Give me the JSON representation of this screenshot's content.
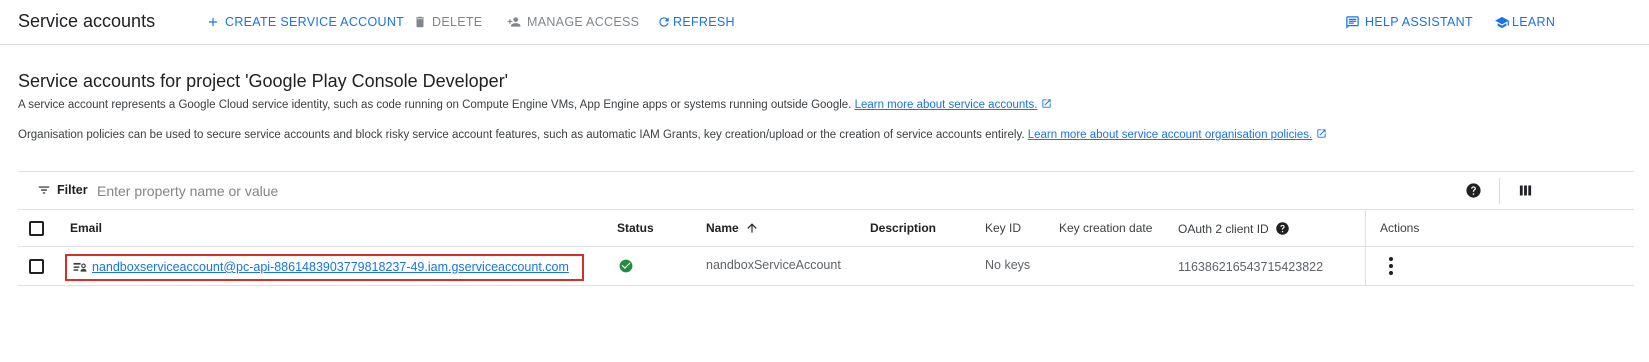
{
  "header": {
    "title": "Service accounts",
    "create_label": "CREATE SERVICE ACCOUNT",
    "delete_label": "DELETE",
    "manage_access_label": "MANAGE ACCESS",
    "refresh_label": "REFRESH",
    "help_assistant_label": "HELP ASSISTANT",
    "learn_label": "LEARN"
  },
  "main": {
    "title": "Service accounts for project 'Google Play Console Developer'",
    "description1": "A service account represents a Google Cloud service identity, such as code running on Compute Engine VMs, App Engine apps or systems running outside Google.",
    "description1_link": "Learn more about service accounts.",
    "description2": "Organisation policies can be used to secure service accounts and block risky service account features, such as automatic IAM Grants, key creation/upload or the creation of service accounts entirely.",
    "description2_link": "Learn more about service account organisation policies."
  },
  "filter": {
    "label": "Filter",
    "placeholder": "Enter property name or value"
  },
  "table": {
    "columns": {
      "email": "Email",
      "status": "Status",
      "name": "Name",
      "description": "Description",
      "key_id": "Key ID",
      "key_creation_date": "Key creation date",
      "oauth_client_id": "OAuth 2 client ID",
      "actions": "Actions"
    },
    "name_sort": "ascending",
    "rows": [
      {
        "email": "nandboxserviceaccount@pc-api-8861483903779818237-49.iam.gserviceaccount.com",
        "status": "enabled",
        "name": "nandboxServiceAccount",
        "description": "",
        "key_id": "No keys",
        "key_creation_date": "",
        "oauth_client_id": "116386216543715423822",
        "checked": false
      }
    ]
  },
  "icons": {
    "create": "plus-icon",
    "delete": "trash-icon",
    "manage_access": "person-add-icon",
    "refresh": "refresh-icon",
    "help_assistant": "chat-icon",
    "learn": "school-icon",
    "filter": "filter-icon",
    "help": "help-circle-icon",
    "columns": "columns-icon",
    "sort": "arrow-up-icon",
    "service_account": "service-account-icon",
    "status": "check-circle-icon",
    "actions": "more-vert-icon",
    "external_link": "open-in-new-icon"
  },
  "colors": {
    "accent": "#1a73e8",
    "disabled_text": "#80868b",
    "status_ok": "#1e8e3e",
    "highlight_border": "#d93025"
  }
}
